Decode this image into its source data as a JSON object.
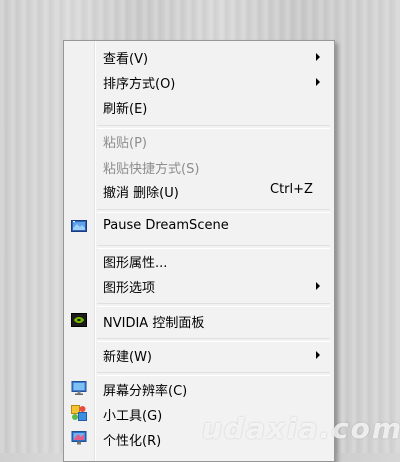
{
  "menu": {
    "view": {
      "label": "查看(V)"
    },
    "sort": {
      "label": "排序方式(O)"
    },
    "refresh": {
      "label": "刷新(E)"
    },
    "paste": {
      "label": "粘贴(P)"
    },
    "paste_shortcut": {
      "label": "粘贴快捷方式(S)"
    },
    "undo_delete": {
      "label": "撤消 删除(U)",
      "shortcut": "Ctrl+Z"
    },
    "pause_dreamscene": {
      "label": "Pause DreamScene"
    },
    "graphics_properties": {
      "label": "图形属性..."
    },
    "graphics_options": {
      "label": "图形选项"
    },
    "nvidia": {
      "label": "NVIDIA 控制面板"
    },
    "new": {
      "label": "新建(W)"
    },
    "screen_resolution": {
      "label": "屏幕分辨率(C)"
    },
    "gadgets": {
      "label": "小工具(G)"
    },
    "personalize": {
      "label": "个性化(R)"
    }
  },
  "icons": {
    "pause_dreamscene": "dreamscene-icon",
    "nvidia": "nvidia-icon",
    "screen_resolution": "monitor-icon",
    "gadgets": "gadgets-icon",
    "personalize": "personalize-icon"
  },
  "watermark": "udaxia.com"
}
